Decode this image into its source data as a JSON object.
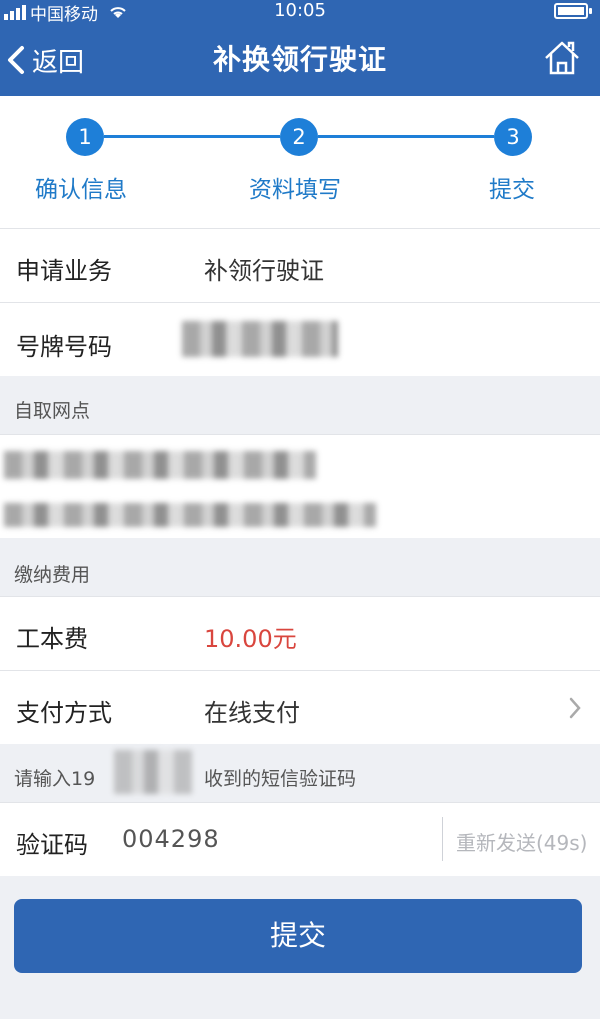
{
  "status_bar": {
    "carrier": "中国移动",
    "time": "10:05"
  },
  "nav": {
    "back_label": "返回",
    "title": "补换领行驶证"
  },
  "steps": [
    {
      "number": "1",
      "label": "确认信息"
    },
    {
      "number": "2",
      "label": "资料填写"
    },
    {
      "number": "3",
      "label": "提交"
    }
  ],
  "info": {
    "business_label": "申请业务",
    "business_value": "补领行驶证",
    "plate_label": "号牌号码"
  },
  "pickup": {
    "section_label": "自取网点"
  },
  "fees": {
    "section_label": "缴纳费用",
    "cost_label": "工本费",
    "cost_value": "10.00元",
    "payment_label": "支付方式",
    "payment_value": "在线支付"
  },
  "sms": {
    "prompt_prefix": "请输入19",
    "prompt_suffix": "收到的短信验证码",
    "code_label": "验证码",
    "code_value": "004298",
    "resend_label": "重新发送(49s)"
  },
  "submit_label": "提交",
  "colors": {
    "primary": "#2f66b3",
    "step": "#1e7fd8",
    "price": "#d9463e"
  }
}
